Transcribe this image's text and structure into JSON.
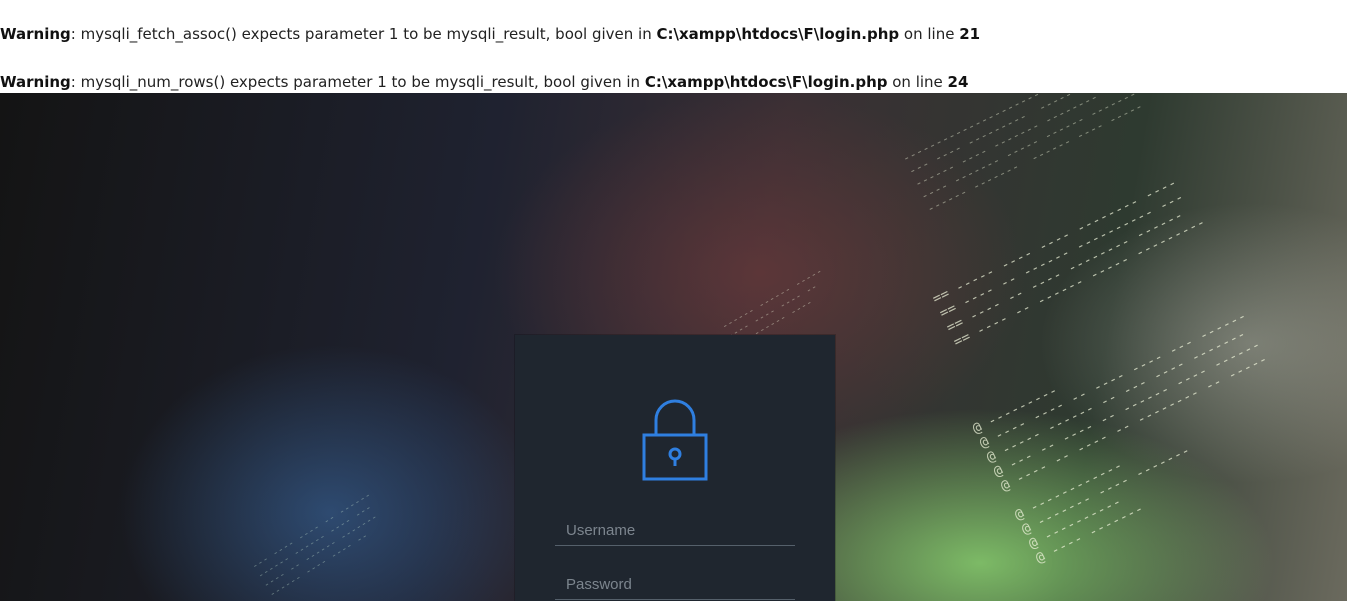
{
  "warnings": [
    {
      "label": "Warning",
      "message": ": mysqli_fetch_assoc() expects parameter 1 to be mysqli_result, bool given in ",
      "file": "C:\\xampp\\htdocs\\F\\login.php",
      "on_line": " on line ",
      "line": "21"
    },
    {
      "label": "Warning",
      "message": ": mysqli_num_rows() expects parameter 1 to be mysqli_result, bool given in ",
      "file": "C:\\xampp\\htdocs\\F\\login.php",
      "on_line": " on line ",
      "line": "24"
    }
  ],
  "login": {
    "icon": "lock-icon",
    "username_placeholder": "Username",
    "password_placeholder": "Password",
    "accent_color": "#2f7fe0",
    "card_color": "#1f262f"
  }
}
